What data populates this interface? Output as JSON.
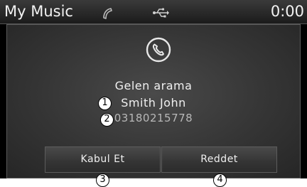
{
  "status_bar": {
    "title": "My Music",
    "clock": "0:00",
    "phone_icon": "phone-handset-icon",
    "usb_icon": "usb-icon"
  },
  "dialog": {
    "call_icon": "phone-call-icon",
    "status_text": "Gelen arama",
    "caller_name": "Smith John",
    "caller_number": "03180215778"
  },
  "buttons": {
    "accept_label": "Kabul Et",
    "reject_label": "Reddet"
  },
  "callouts": {
    "name": "1",
    "number": "2",
    "accept": "3",
    "reject": "4"
  },
  "colors": {
    "background": "#000000",
    "dialog": "#3a3a3a",
    "text": "#f0f0f0",
    "secondary_text": "#b8b8b8"
  }
}
